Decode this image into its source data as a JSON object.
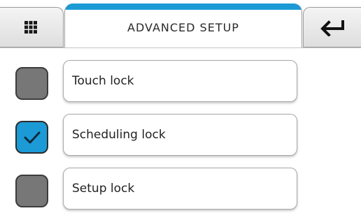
{
  "header": {
    "title": "ADVANCED SETUP",
    "menu_icon": "grid-icon",
    "back_icon": "return-arrow-icon"
  },
  "settings": [
    {
      "label": "Touch lock",
      "checked": false
    },
    {
      "label": "Scheduling lock",
      "checked": true
    },
    {
      "label": "Setup lock",
      "checked": false
    }
  ],
  "colors": {
    "accent": "#1c9ad6",
    "unchecked": "#777777"
  }
}
